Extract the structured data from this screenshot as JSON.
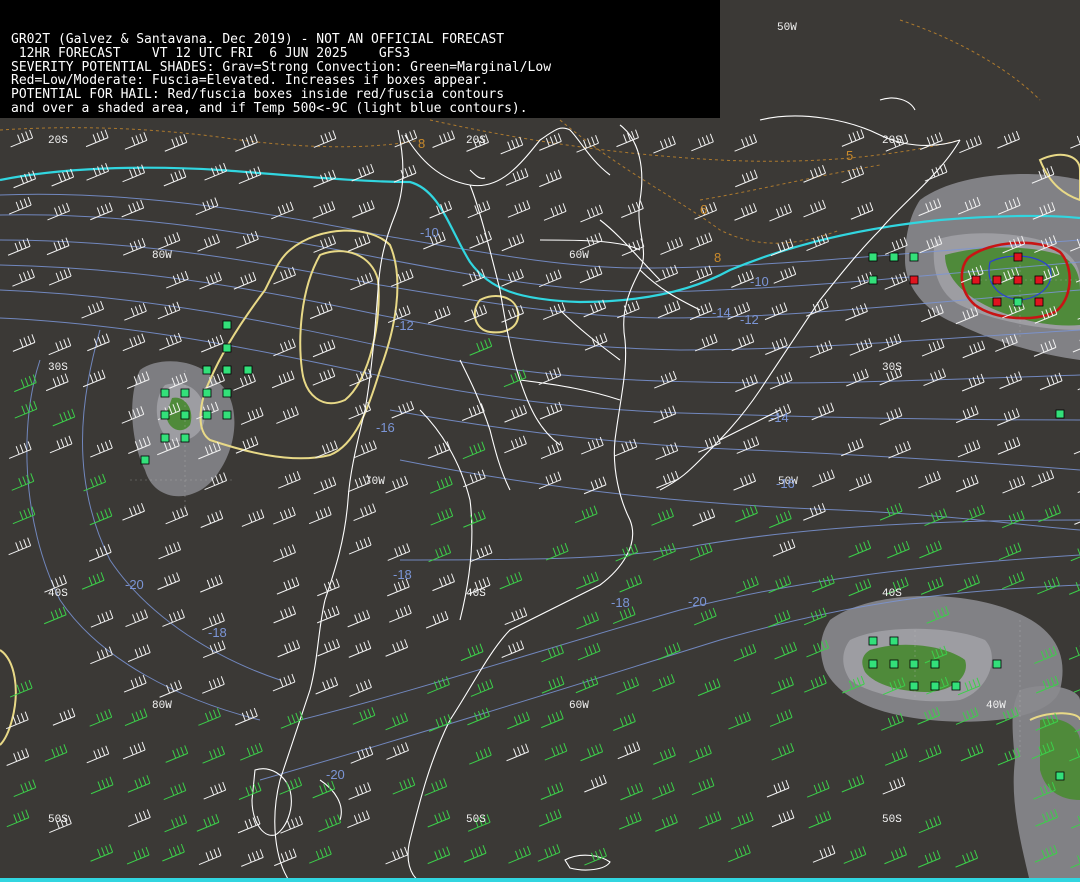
{
  "header": {
    "line1": "GR02T (Galvez & Santavana. Dec 2019) - NOT AN OFFICIAL FORECAST",
    "line2": " 12HR FORECAST    VT 12 UTC FRI  6 JUN 2025    GFS3",
    "line3": "SEVERITY POTENTIAL SHADES: Grav=Strong Convection: Green=Marginal/Low",
    "line4": "Red=Low/Moderate: Fuscia=Elevated. Increases if boxes appear.",
    "line5": "POTENTIAL FOR HAIL: Red/fuscia boxes inside red/fuscia contours",
    "line6": "and over a shaded area, and if Temp 500<-9C (light blue contours)."
  },
  "grid_labels": {
    "lon_50w_top": "50W",
    "lat_20s_left": "20S",
    "lat_20s_mid": "20S",
    "lat_20s_right": "20S",
    "lon_80w_a": "80W",
    "lon_60w_a": "60W",
    "lat_30s_left": "30S",
    "lat_30s_right": "30S",
    "lon_70w": "70W",
    "lon_50w_mid": "50W",
    "lat_40s_left": "40S",
    "lat_40s_mid": "40S",
    "lat_40s_right": "40S",
    "lon_80w_b": "80W",
    "lon_60w_b": "60W",
    "lon_40w": "40W",
    "lat_50s_left": "50S",
    "lat_50s_mid": "50S",
    "lat_50s_right": "50S"
  },
  "temp_labels": {
    "t1": "-20",
    "t2": "-18",
    "t3": "-18",
    "t4": "-16",
    "t5": "-14",
    "t6": "-12",
    "t7": "-10",
    "t8": "-12",
    "t9": "-18",
    "t10": "-20",
    "t11": "-20",
    "t12": "-16",
    "t13": "-14",
    "t14": "-10"
  },
  "height_labels": {
    "h1": "8",
    "h2": "6",
    "h3": "8",
    "h4": "5"
  },
  "colors": {
    "background": "#3b3936",
    "coastline": "#ffffff",
    "temp_contour": "#7b95d6",
    "cold_contour": "#31d6e0",
    "height_contour": "#c98a2c",
    "yellow_contour": "#e8d987",
    "gray_shade": "#8a8a8e",
    "green_shade": "#4f8a3a",
    "green_box": "#33e07a",
    "red_box": "#e0141e",
    "red_contour": "#c81414",
    "wind_barb_white": "#f2f2f2",
    "wind_barb_green": "#3ccf4a"
  }
}
